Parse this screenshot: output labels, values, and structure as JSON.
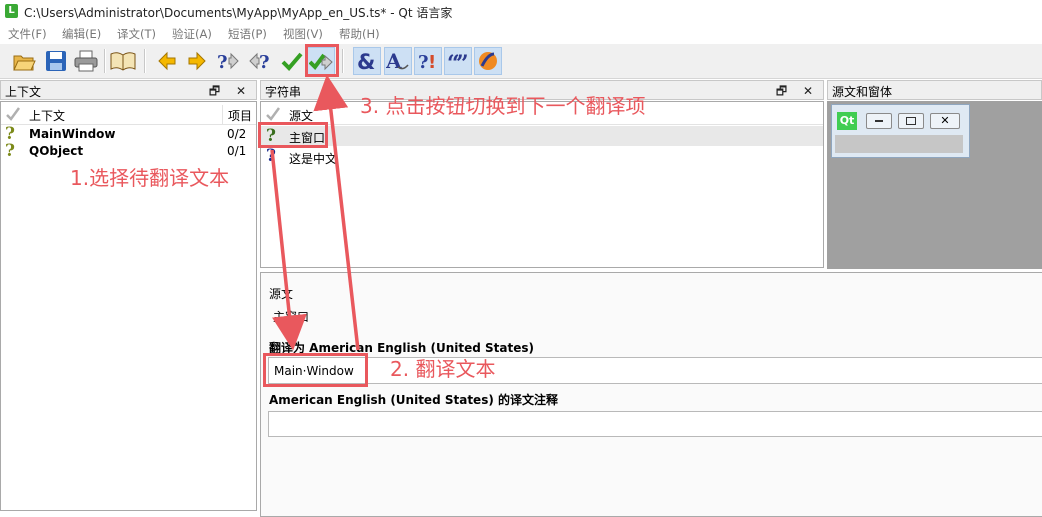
{
  "window": {
    "title": "C:\\Users\\Administrator\\Documents\\MyApp\\MyApp_en_US.ts* - Qt 语言家",
    "app_icon": "L"
  },
  "menu": [
    "文件(F)",
    "编辑(E)",
    "译文(T)",
    "验证(A)",
    "短语(P)",
    "视图(V)",
    "帮助(H)"
  ],
  "toolbar": {
    "icons": [
      "open-folder-icon",
      "save-icon",
      "print-icon",
      "phrasebook-icon",
      "prev-icon",
      "next-icon",
      "prev-unfinished-icon",
      "next-unfinished-icon",
      "done-icon",
      "done-and-next-icon",
      "accelerators-icon",
      "ending-punctuation-icon",
      "phrase-matches-icon",
      "place-markers-icon",
      "similar-text-icon"
    ]
  },
  "context_panel": {
    "title": "上下文",
    "columns": [
      "上下文",
      "项目"
    ],
    "rows": [
      {
        "name": "MainWindow",
        "count": "0/2",
        "status": "?"
      },
      {
        "name": "QObject",
        "count": "0/1",
        "status": "?"
      }
    ]
  },
  "strings_panel": {
    "title": "字符串",
    "columns": [
      "源文"
    ],
    "rows": [
      {
        "text": "主窗口",
        "status": "?",
        "color": "#3a6e1e"
      },
      {
        "text": "这是中文",
        "status": "?",
        "color": "#1a2a8c"
      }
    ]
  },
  "preview_panel": {
    "title": "源文和窗体",
    "qt_logo": "Qt"
  },
  "editor": {
    "source_label": "源文",
    "source_text": "主窗口",
    "translation_label": "翻译为 American English (United States)",
    "translation_value": "Main·Window",
    "comment_label": "American English (United States) 的译文注释",
    "comment_value": ""
  },
  "annotations": {
    "step1": "1.选择待翻译文本",
    "step2": "2. 翻译文本",
    "step3": "3. 点击按钮切换到下一个翻译项",
    "color": "#e9585d"
  },
  "dock_buttons": "🗗 ✕"
}
